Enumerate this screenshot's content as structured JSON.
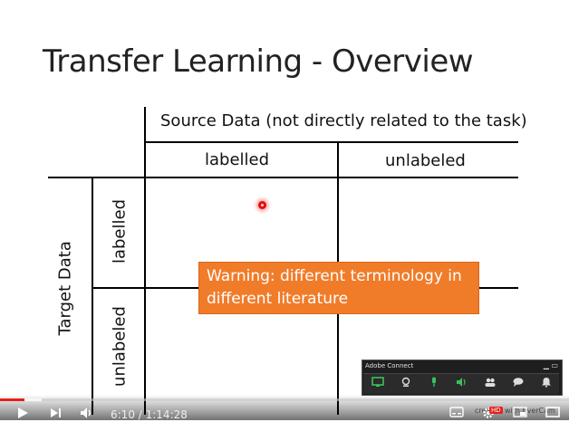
{
  "slide": {
    "title": "Transfer Learning - Overview",
    "source_header": "Source Data (not directly related to the task)",
    "source_labelled": "labelled",
    "source_unlabeled": "unlabeled",
    "target_header": "Target Data",
    "target_labelled": "labelled",
    "target_unlabeled": "unlabeled",
    "warning": "Warning: different terminology in different literature"
  },
  "adobe_connect": {
    "title": "Adobe Connect",
    "window_buttons": "▁ ▭",
    "icons": [
      "screen-share-icon",
      "webcam-icon",
      "microphone-icon",
      "speaker-icon",
      "attendees-icon",
      "chat-icon",
      "notification-icon"
    ]
  },
  "player": {
    "time": "6:10 / 1:14:28",
    "progress_fraction": 0.083,
    "hd_badge": "HD",
    "watermark": "created with EverCam"
  },
  "colors": {
    "warning_bg": "#f07c2a",
    "progress": "#e62117",
    "adobe_green": "#39c15a"
  }
}
